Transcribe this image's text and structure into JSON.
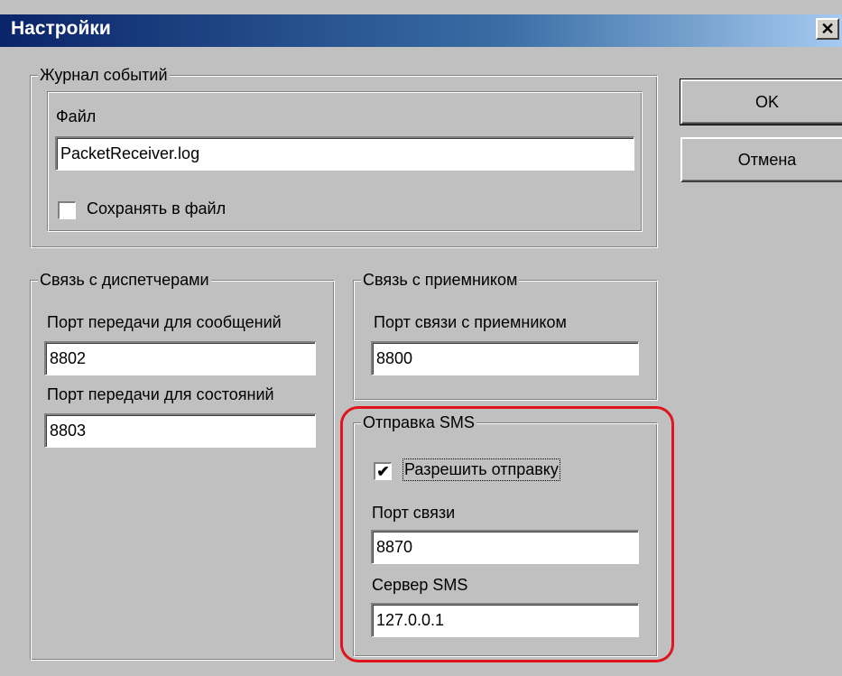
{
  "window": {
    "title": "Настройки"
  },
  "buttons": {
    "ok": "OK",
    "cancel": "Отмена"
  },
  "event_log": {
    "legend": "Журнал событий",
    "file_label": "Файл",
    "file_value": "PacketReceiver.log",
    "save_label": "Сохранять в файл",
    "save_checked": false
  },
  "dispatchers": {
    "legend": "Связь с диспетчерами",
    "msg_port_label": "Порт передачи для сообщений",
    "msg_port_value": "8802",
    "state_port_label": "Порт передачи для состояний",
    "state_port_value": "8803"
  },
  "receiver": {
    "legend": "Связь с приемником",
    "port_label": "Порт связи с приемником",
    "port_value": "8800"
  },
  "sms": {
    "legend": "Отправка SMS",
    "enable_label": "Разрешить отправку",
    "enable_checked": true,
    "port_label": "Порт связи",
    "port_value": "8870",
    "server_label": "Сервер SMS",
    "server_value": "127.0.0.1"
  },
  "colors": {
    "highlight": "#e0141e",
    "titlebar": "#0a246a"
  }
}
